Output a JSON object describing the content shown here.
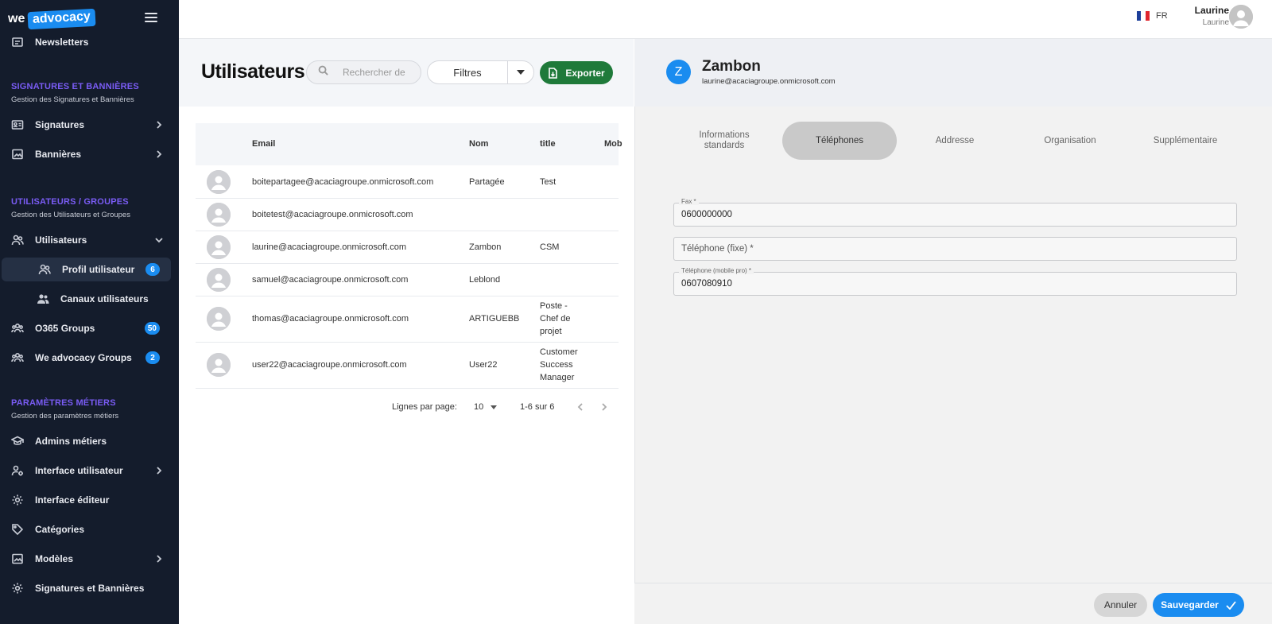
{
  "brand": {
    "we": "we",
    "advocacy": "advocacy"
  },
  "sidebar": {
    "newsletters_label": "Newsletters",
    "sections": [
      {
        "title": "SIGNATURES ET BANNIÈRES",
        "subtitle": "Gestion des Signatures et Bannières"
      },
      {
        "title": "UTILISATEURS / GROUPES",
        "subtitle": "Gestion des Utilisateurs et Groupes"
      },
      {
        "title": "PARAMÈTRES MÉTIERS",
        "subtitle": "Gestion des paramètres métiers"
      }
    ],
    "items": [
      {
        "label": "Signatures"
      },
      {
        "label": "Bannières"
      },
      {
        "label": "Utilisateurs"
      },
      {
        "label": "Profil utilisateur",
        "badge": "6"
      },
      {
        "label": "Canaux utilisateurs"
      },
      {
        "label": "O365 Groups",
        "badge": "50"
      },
      {
        "label": "We advocacy Groups",
        "badge": "2"
      },
      {
        "label": "Admins métiers"
      },
      {
        "label": "Interface utilisateur"
      },
      {
        "label": "Interface éditeur"
      },
      {
        "label": "Catégories"
      },
      {
        "label": "Modèles"
      },
      {
        "label": "Signatures et Bannières"
      }
    ]
  },
  "header": {
    "lang": "FR",
    "user_name": "Laurine",
    "user_sub": "Laurine"
  },
  "list": {
    "title": "Utilisateurs",
    "search_placeholder": "Rechercher de",
    "filter_label": "Filtres",
    "export_label": "Exporter",
    "columns": [
      "Email",
      "Nom",
      "title",
      "Mob"
    ],
    "rows": [
      {
        "email": "boitepartagee@acaciagroupe.onmicrosoft.com",
        "nom": "Partagée",
        "title": "Test"
      },
      {
        "email": "boitetest@acaciagroupe.onmicrosoft.com",
        "nom": "",
        "title": ""
      },
      {
        "email": "laurine@acaciagroupe.onmicrosoft.com",
        "nom": "Zambon",
        "title": "CSM"
      },
      {
        "email": "samuel@acaciagroupe.onmicrosoft.com",
        "nom": "Leblond",
        "title": ""
      },
      {
        "email": "thomas@acaciagroupe.onmicrosoft.com",
        "nom": "ARTIGUEBB",
        "title_lines": [
          "Poste -",
          "Chef de",
          "projet"
        ]
      },
      {
        "email": "user22@acaciagroupe.onmicrosoft.com",
        "nom": "User22",
        "title_lines": [
          "Customer",
          "Success",
          "Manager"
        ]
      }
    ],
    "pagination": {
      "rows_per_page_label": "Lignes par page:",
      "rows_per_page": "10",
      "range": "1-6 sur 6"
    }
  },
  "detail": {
    "initial": "Z",
    "name": "Zambon",
    "email": "laurine@acaciagroupe.onmicrosoft.com",
    "tabs": [
      {
        "label_lines": [
          "Informations",
          "standards"
        ]
      },
      {
        "label": "Téléphones",
        "active": true
      },
      {
        "label": "Addresse"
      },
      {
        "label": "Organisation"
      },
      {
        "label": "Supplémentaire"
      }
    ],
    "fields": [
      {
        "label": "Fax *",
        "value": "0600000000",
        "placeholder": ""
      },
      {
        "label": "",
        "value": "",
        "placeholder": "Téléphone (fixe) *"
      },
      {
        "label": "Téléphone (mobile pro) *",
        "value": "0607080910",
        "placeholder": ""
      }
    ],
    "cancel_label": "Annuler",
    "save_label": "Sauvegarder"
  },
  "colors": {
    "sidebar_bg": "#141c2c",
    "accent_blue": "#1a8cf0",
    "section_purple": "#7a5cf5",
    "export_green": "#1f7a3a"
  }
}
